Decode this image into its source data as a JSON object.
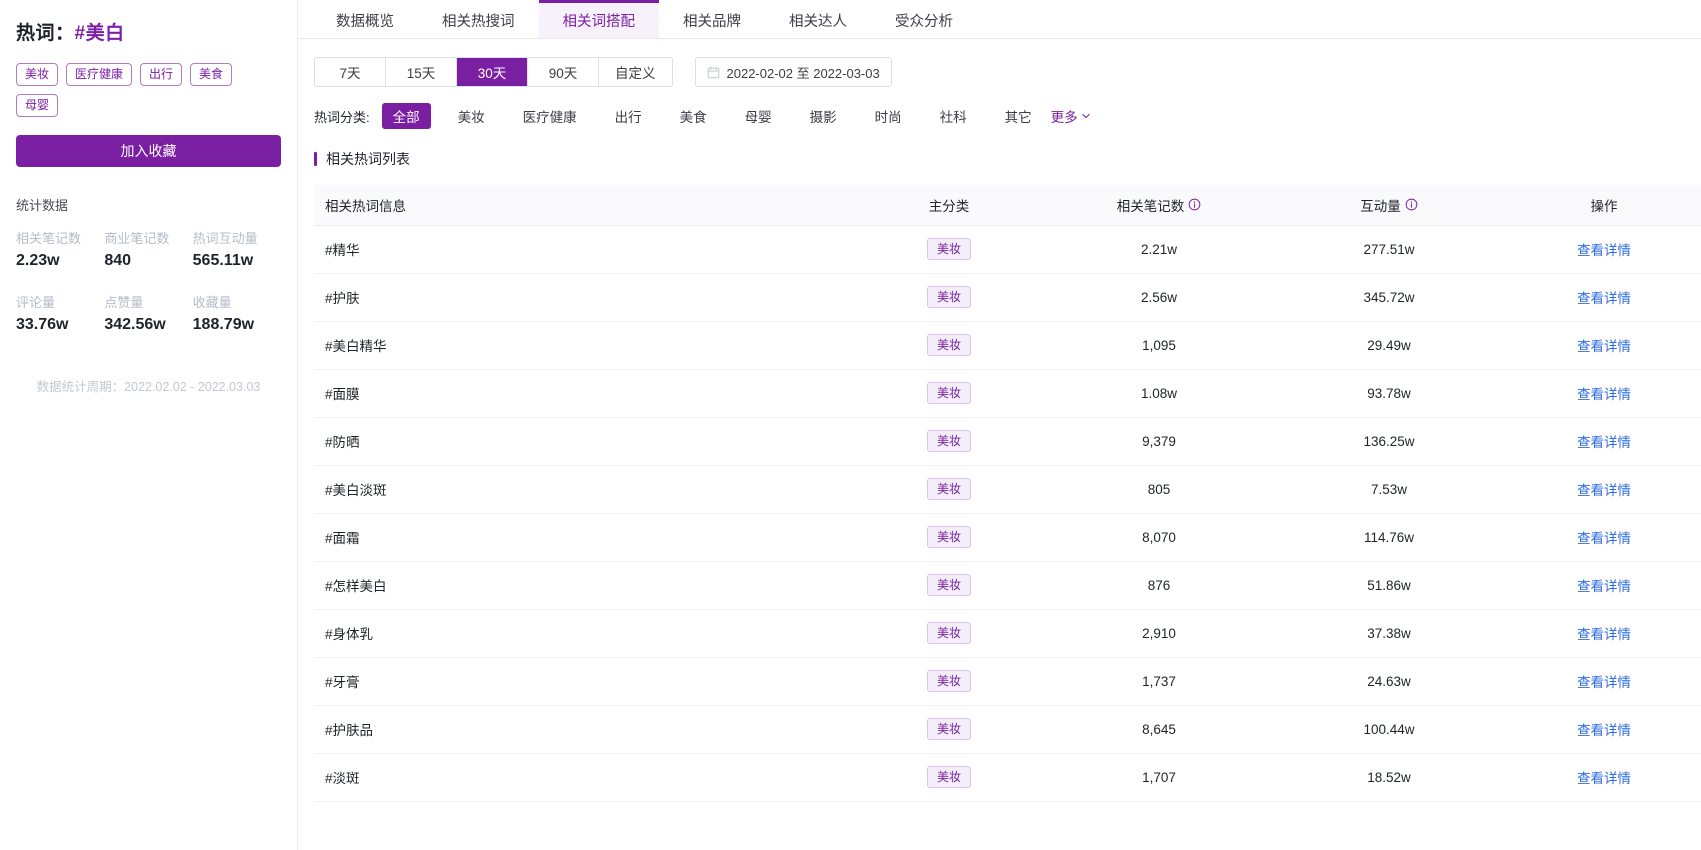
{
  "sidebar": {
    "title_prefix": "热词：",
    "keyword": "#美白",
    "tags": [
      "美妆",
      "医疗健康",
      "出行",
      "美食",
      "母婴"
    ],
    "favorite_button": "加入收藏",
    "stats_title": "统计数据",
    "stats": [
      {
        "label": "相关笔记数",
        "value": "2.23w"
      },
      {
        "label": "商业笔记数",
        "value": "840"
      },
      {
        "label": "热词互动量",
        "value": "565.11w"
      },
      {
        "label": "评论量",
        "value": "33.76w"
      },
      {
        "label": "点赞量",
        "value": "342.56w"
      },
      {
        "label": "收藏量",
        "value": "188.79w"
      }
    ],
    "period_note": "数据统计周期：2022.02.02 - 2022.03.03"
  },
  "tabs": [
    {
      "label": "数据概览",
      "active": false
    },
    {
      "label": "相关热搜词",
      "active": false
    },
    {
      "label": "相关词搭配",
      "active": true
    },
    {
      "label": "相关品牌",
      "active": false
    },
    {
      "label": "相关达人",
      "active": false
    },
    {
      "label": "受众分析",
      "active": false
    }
  ],
  "filters": {
    "ranges": [
      {
        "label": "7天",
        "active": false
      },
      {
        "label": "15天",
        "active": false
      },
      {
        "label": "30天",
        "active": true
      },
      {
        "label": "90天",
        "active": false
      },
      {
        "label": "自定义",
        "active": false
      }
    ],
    "date_range": "2022-02-02 至 2022-03-03",
    "date_icon": "calendar-icon",
    "category_label": "热词分类:",
    "categories": [
      {
        "label": "全部",
        "active": true
      },
      {
        "label": "美妆",
        "active": false
      },
      {
        "label": "医疗健康",
        "active": false
      },
      {
        "label": "出行",
        "active": false
      },
      {
        "label": "美食",
        "active": false
      },
      {
        "label": "母婴",
        "active": false
      },
      {
        "label": "摄影",
        "active": false
      },
      {
        "label": "时尚",
        "active": false
      },
      {
        "label": "社科",
        "active": false
      },
      {
        "label": "其它",
        "active": false
      }
    ],
    "more_label": "更多",
    "more_icon": "chevron-down-icon"
  },
  "table": {
    "section_title": "相关热词列表",
    "columns": {
      "info": "相关热词信息",
      "category": "主分类",
      "notes": "相关笔记数",
      "interactions": "互动量",
      "action": "操作"
    },
    "action_label": "查看详情",
    "rows": [
      {
        "name": "#精华",
        "category": "美妆",
        "notes": "2.21w",
        "interactions": "277.51w"
      },
      {
        "name": "#护肤",
        "category": "美妆",
        "notes": "2.56w",
        "interactions": "345.72w"
      },
      {
        "name": "#美白精华",
        "category": "美妆",
        "notes": "1,095",
        "interactions": "29.49w"
      },
      {
        "name": "#面膜",
        "category": "美妆",
        "notes": "1.08w",
        "interactions": "93.78w"
      },
      {
        "name": "#防晒",
        "category": "美妆",
        "notes": "9,379",
        "interactions": "136.25w"
      },
      {
        "name": "#美白淡斑",
        "category": "美妆",
        "notes": "805",
        "interactions": "7.53w"
      },
      {
        "name": "#面霜",
        "category": "美妆",
        "notes": "8,070",
        "interactions": "114.76w"
      },
      {
        "name": "#怎样美白",
        "category": "美妆",
        "notes": "876",
        "interactions": "51.86w"
      },
      {
        "name": "#身体乳",
        "category": "美妆",
        "notes": "2,910",
        "interactions": "37.38w"
      },
      {
        "name": "#牙膏",
        "category": "美妆",
        "notes": "1,737",
        "interactions": "24.63w"
      },
      {
        "name": "#护肤品",
        "category": "美妆",
        "notes": "8,645",
        "interactions": "100.44w"
      },
      {
        "name": "#淡斑",
        "category": "美妆",
        "notes": "1,707",
        "interactions": "18.52w"
      }
    ]
  },
  "colors": {
    "brand": "#7b1fa2",
    "link": "#2e6be6",
    "badge_bg": "#f3eefa"
  }
}
